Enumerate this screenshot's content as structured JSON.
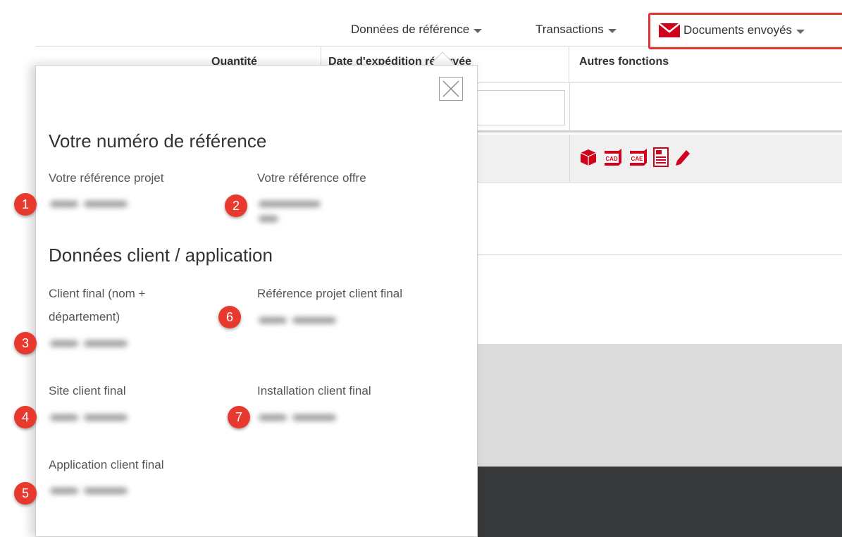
{
  "nav": {
    "reference_data": "Données de référence",
    "transactions": "Transactions",
    "sent_documents": "Documents envoyés"
  },
  "table": {
    "col_quantity": "Quantité",
    "col_date": "Date d'expédition réservée",
    "col_other": "Autres fonctions",
    "row_icons": [
      "cube-icon",
      "cad-icon",
      "cae-icon",
      "document-icon",
      "pencil-icon"
    ]
  },
  "popover": {
    "section1_title": "Votre numéro de référence",
    "section2_title": "Données client / application",
    "fields": {
      "project_ref": {
        "badge": "1",
        "label": "Votre référence projet"
      },
      "offer_ref": {
        "badge": "2",
        "label": "Votre référence offre"
      },
      "end_customer": {
        "badge": "3",
        "label_line1": "Client final (nom +",
        "label_line2": "département)"
      },
      "end_customer_project_ref": {
        "badge": "6",
        "label": "Référence projet client final"
      },
      "end_customer_site": {
        "badge": "4",
        "label": "Site client final"
      },
      "end_customer_installation": {
        "badge": "7",
        "label": "Installation client final"
      },
      "end_customer_application": {
        "badge": "5",
        "label": "Application client final"
      }
    }
  },
  "colors": {
    "accent": "#e2332f",
    "badge": "#e8392f",
    "icon_red": "#d0021b",
    "dark_band": "#37383a",
    "gray_band": "#dcdcdc"
  }
}
